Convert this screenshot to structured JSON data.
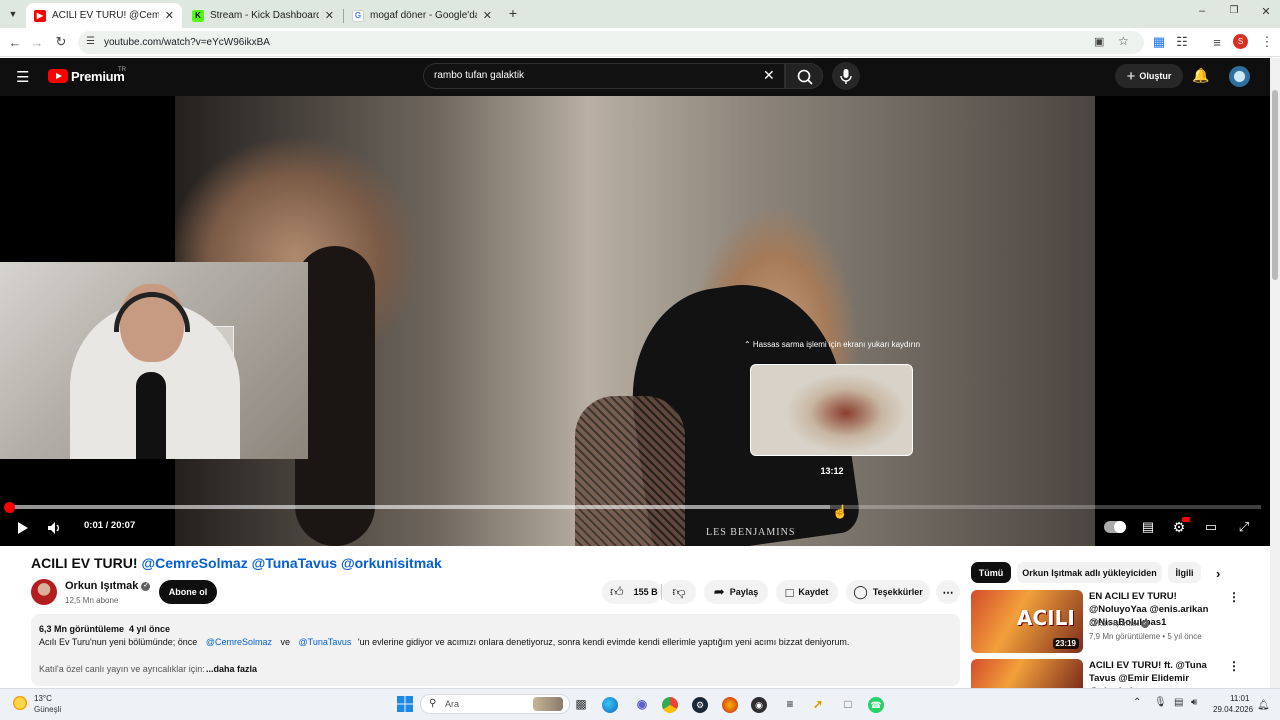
{
  "browser": {
    "tabs": [
      {
        "title": "ACILI EV TURU! @CemreSolma...",
        "active": true,
        "icon": "youtube-icon",
        "icon_color": "#ff0000"
      },
      {
        "title": "Stream - Kick Dashboard",
        "active": false,
        "icon": "kick-icon",
        "icon_color": "#53fc18"
      },
      {
        "title": "mogaf döner - Google'da Ara",
        "active": false,
        "icon": "google-icon",
        "icon_color": "#4285f4"
      }
    ],
    "url": "youtube.com/watch?v=eYcW96ikxBA",
    "profile_initial": "S"
  },
  "masthead": {
    "logo_text": "Premium",
    "logo_region": "TR",
    "search_query": "rambo tufan galaktik",
    "create_label": "Oluştur"
  },
  "player": {
    "preview_tip": "Hassas sarma işlemi için ekranı yukarı kaydırın",
    "preview_time": "13:12",
    "time_display": "0:01 / 20:07",
    "watermark": "LES BENJAMINS",
    "progress": {
      "played_fraction": 0.0008,
      "hover_fraction": 0.656
    }
  },
  "video": {
    "title_plain": "ACILI EV TURU!",
    "title_tags": "@CemreSolmaz @TunaTavus @orkunisitmak",
    "channel": "Orkun Işıtmak",
    "subscribers": "12,5 Mn abone",
    "subscribe_label": "Abone ol",
    "likes": "155 B",
    "share_label": "Paylaş",
    "save_label": "Kaydet",
    "thanks_label": "Teşekkürler",
    "views_age": "6,3 Mn görüntüleme  4 yıl önce",
    "desc_part1": "Acılı Ev Turu'nun yeni bölümünde; önce",
    "desc_mention1": "@CemreSolmaz",
    "desc_and": "ve",
    "desc_mention2": "@TunaTavus",
    "desc_part2": "'un evlerine gidiyor ve acımızı onlara denetiyoruz, sonra kendi evimde kendi ellerimle yaptığım yeni acımı bizzat deniyorum.",
    "desc_line2": "Katıl'a özel canlı yayın ve ayrıcalıklar için:",
    "more_label": "...daha fazla"
  },
  "sidebar": {
    "chips": [
      "Tümü",
      "Orkun Işıtmak adlı yükleyiciden",
      "İlgili"
    ],
    "related": [
      {
        "title": "EN ACILI EV TURU! @NoluyoYaa @enis.arikan @NisaBolukbas1",
        "channel": "Orkun Işıtmak",
        "meta": "7,9 Mn görüntüleme • 5 yıl önce",
        "duration": "23:19",
        "thumb_word": "ACILI"
      },
      {
        "title": "ACILI EV TURU! ft. @Tuna Tavus @Emir Elidemir  @uberkuloz",
        "channel": "",
        "meta": "",
        "duration": "",
        "thumb_word": ""
      }
    ]
  },
  "taskbar": {
    "weather_temp": "13°C",
    "weather_desc": "Güneşli",
    "search_placeholder": "Ara",
    "time": "11:01",
    "date": "29.04.2026"
  },
  "colors": {
    "yt_red": "#ff0000",
    "link_blue": "#065fd4",
    "masthead_bg": "#0f0f0f"
  }
}
